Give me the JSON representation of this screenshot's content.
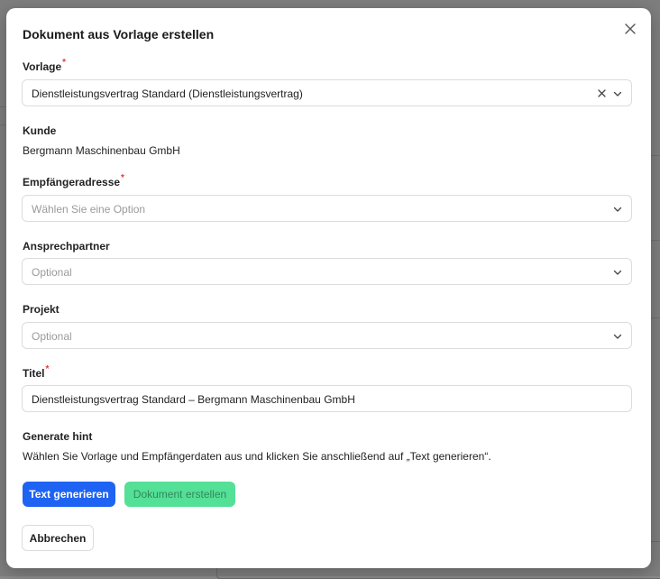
{
  "dialog": {
    "title": "Dokument aus Vorlage erstellen",
    "vorlage": {
      "label": "Vorlage",
      "required": "*",
      "value": "Dienstleistungsvertrag Standard (Dienstleistungsvertrag)"
    },
    "kunde": {
      "label": "Kunde",
      "value": "Bergmann Maschinenbau GmbH"
    },
    "empfaenger": {
      "label": "Empfängeradresse",
      "required": "*",
      "placeholder": "Wählen Sie eine Option"
    },
    "ansprechpartner": {
      "label": "Ansprechpartner",
      "placeholder": "Optional"
    },
    "projekt": {
      "label": "Projekt",
      "placeholder": "Optional"
    },
    "titel": {
      "label": "Titel",
      "required": "*",
      "value": "Dienstleistungsvertrag Standard – Bergmann Maschinenbau GmbH"
    },
    "hint": {
      "label": "Generate hint",
      "text": "Wählen Sie Vorlage und Empfängerdaten aus und klicken Sie anschließend auf „Text generieren“."
    },
    "buttons": {
      "generate": "Text generieren",
      "create": "Dokument erstellen",
      "cancel": "Abbrechen"
    },
    "icons": {
      "close": "close-icon",
      "clear": "clear-icon",
      "chevron": "chevron-down-icon"
    },
    "colors": {
      "primary": "#1f63f3",
      "success": "#54e096",
      "required": "#e23b3b"
    }
  }
}
